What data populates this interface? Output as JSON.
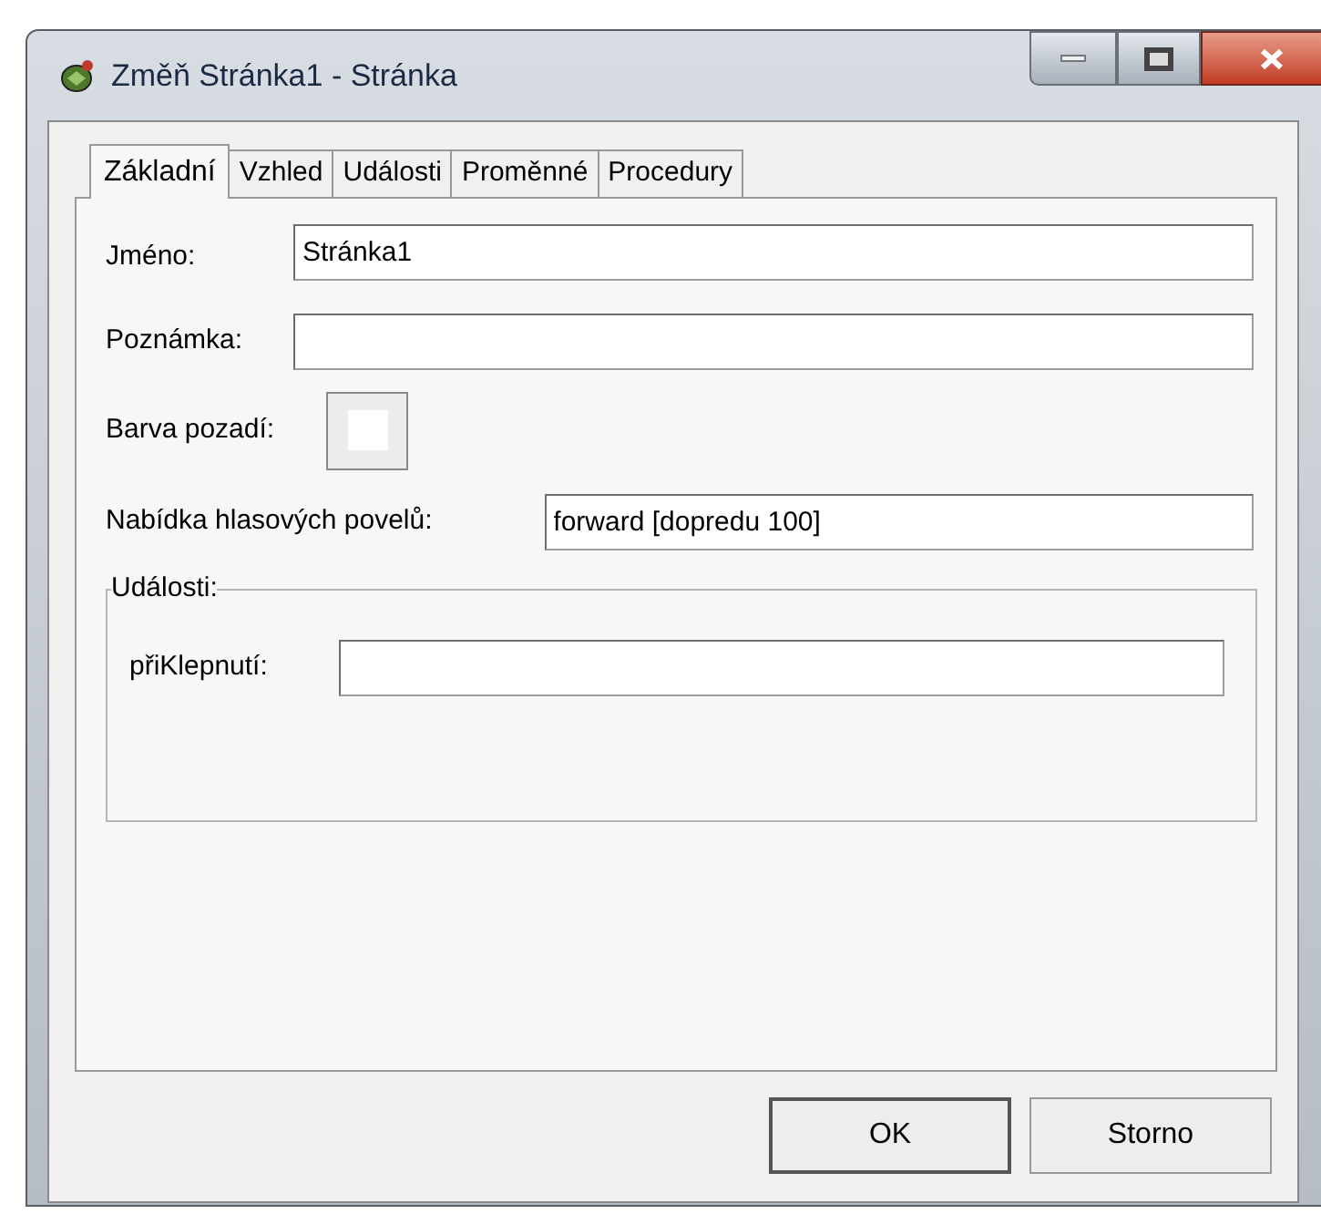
{
  "window": {
    "title": "Změň Stránka1  - Stránka"
  },
  "tabs": [
    {
      "label": "Základní",
      "selected": true
    },
    {
      "label": "Vzhled",
      "selected": false
    },
    {
      "label": "Události",
      "selected": false
    },
    {
      "label": "Proměnné",
      "selected": false
    },
    {
      "label": "Procedury",
      "selected": false
    }
  ],
  "fields": {
    "name": {
      "label": "Jméno:",
      "value": "Stránka1"
    },
    "note": {
      "label": "Poznámka:"
    },
    "background": {
      "label": "Barva pozadí:",
      "color": "#ffffff"
    },
    "voice_menu": {
      "label": "Nabídka hlasových povelů:",
      "value": "forward [dopredu 100]"
    }
  },
  "events_group": {
    "title": "Události:",
    "on_click": {
      "label": "přiKlepnutí:"
    }
  },
  "buttons": [
    "OK",
    "Storno"
  ]
}
